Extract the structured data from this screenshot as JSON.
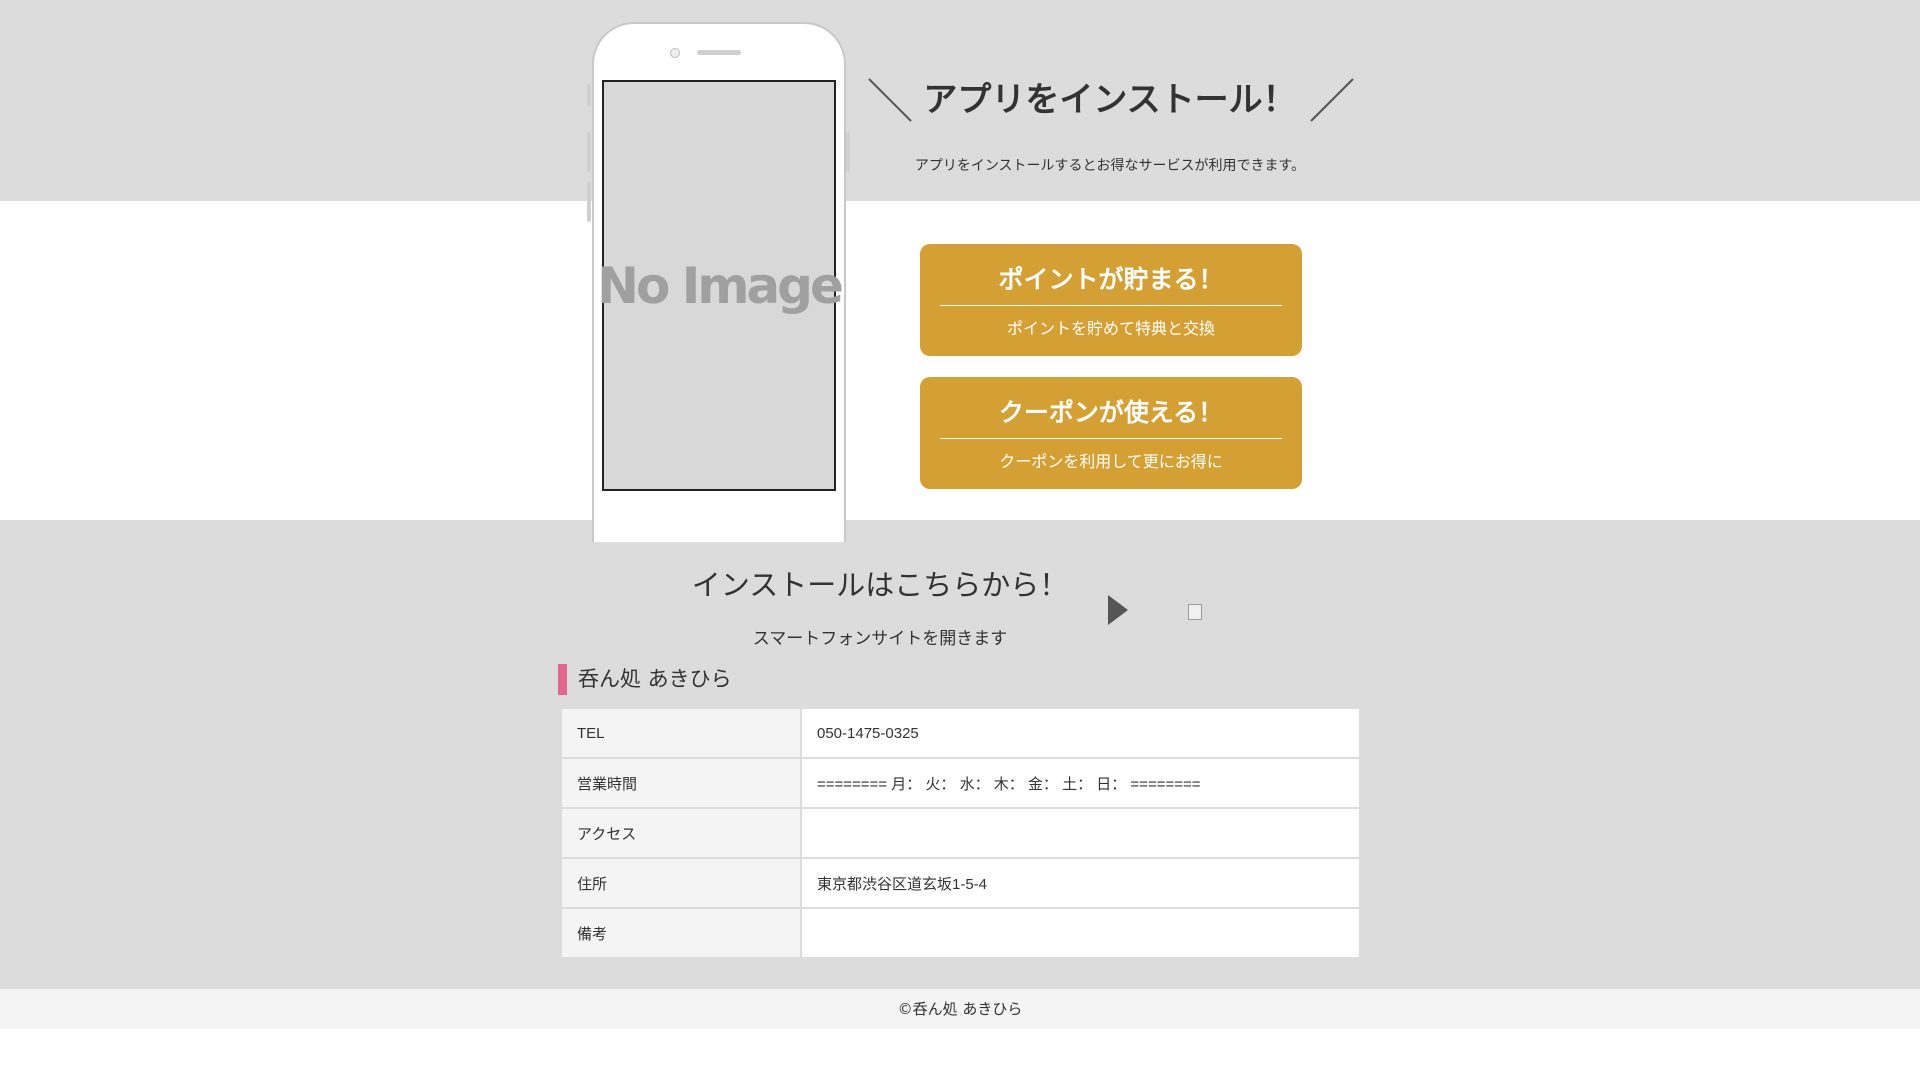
{
  "phone": {
    "placeholder_text": "No Image"
  },
  "install_section": {
    "title": "アプリをインストール！",
    "subtitle": "アプリをインストールするとお得なサービスが利用できます。"
  },
  "features": [
    {
      "title": "ポイントが貯まる！",
      "subtitle": "ポイントを貯めて特典と交換"
    },
    {
      "title": "クーポンが使える！",
      "subtitle": "クーポンを利用して更にお得に"
    }
  ],
  "install_link": {
    "title": "インストールはこちらから！",
    "subtitle": "スマートフォンサイトを開きます",
    "arrow_icon": "play-triangle-icon",
    "image_icon": "broken-image-icon"
  },
  "shop": {
    "name": "呑ん処 あきひら",
    "accent_color": "#e2678f",
    "rows": [
      {
        "label": "TEL",
        "value": "050-1475-0325"
      },
      {
        "label": "営業時間",
        "value": "======== 月： 火： 水： 木： 金： 土： 日： ========"
      },
      {
        "label": "アクセス",
        "value": ""
      },
      {
        "label": "住所",
        "value": "東京都渋谷区道玄坂1-5-4"
      },
      {
        "label": "備考",
        "value": ""
      }
    ]
  },
  "footer": {
    "copyright": "©呑ん処 あきひら"
  },
  "colors": {
    "card": "#d4a033",
    "band": "#dcdcdc"
  }
}
